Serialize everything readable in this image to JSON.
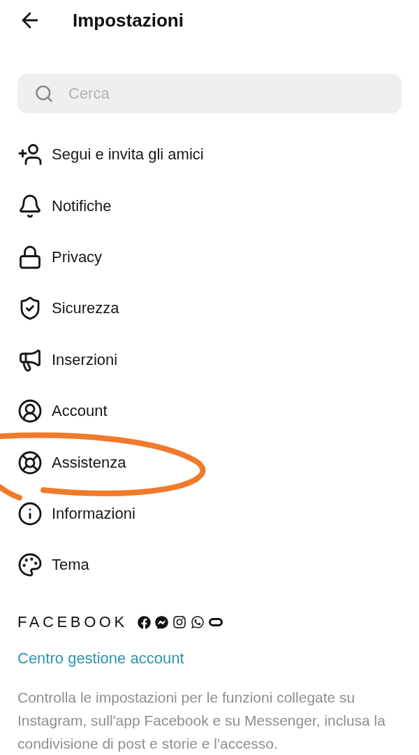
{
  "header": {
    "title": "Impostazioni"
  },
  "search": {
    "placeholder": "Cerca"
  },
  "menu": [
    {
      "label": "Segui e invita gli amici",
      "annotated": false
    },
    {
      "label": "Notifiche",
      "annotated": false
    },
    {
      "label": "Privacy",
      "annotated": false
    },
    {
      "label": "Sicurezza",
      "annotated": false
    },
    {
      "label": "Inserzioni",
      "annotated": false
    },
    {
      "label": "Account",
      "annotated": false
    },
    {
      "label": "Assistenza",
      "annotated": true
    },
    {
      "label": "Informazioni",
      "annotated": false
    },
    {
      "label": "Tema",
      "annotated": false
    }
  ],
  "facebook_section": {
    "heading": "FACEBOOK",
    "link": "Centro gestione account",
    "description": "Controlla le impostazioni per le funzioni collegate su Instagram, sull'app Facebook e su Messenger, inclusa la condivisione di post e storie e l'accesso."
  }
}
